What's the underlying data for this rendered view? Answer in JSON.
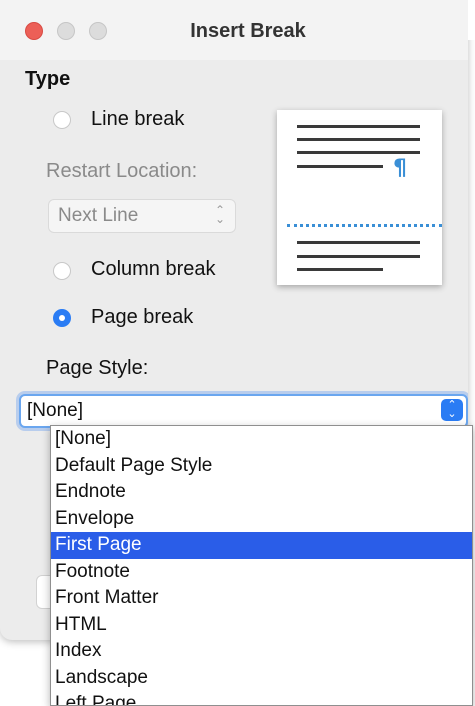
{
  "window": {
    "title": "Insert Break"
  },
  "type_section": {
    "title": "Type"
  },
  "options": {
    "line_break": "Line break",
    "restart_location_label": "Restart Location:",
    "restart_location_value": "Next Line",
    "column_break": "Column break",
    "page_break": "Page break",
    "selected": "page_break"
  },
  "page_style": {
    "label": "Page Style:",
    "value": "[None]",
    "options": [
      "[None]",
      "Default Page Style",
      "Endnote",
      "Envelope",
      "First Page",
      "Footnote",
      "Front Matter",
      "HTML",
      "Index",
      "Landscape",
      "Left Page"
    ],
    "highlighted": "First Page"
  },
  "colors": {
    "accent": "#2a7cf4",
    "highlight": "#2a5de8",
    "preview_blue": "#3a8fd6",
    "close": "#ec5f57"
  },
  "icons": {
    "preview_pilcrow": "¶",
    "stepper": "up-down-chevron-icon"
  }
}
